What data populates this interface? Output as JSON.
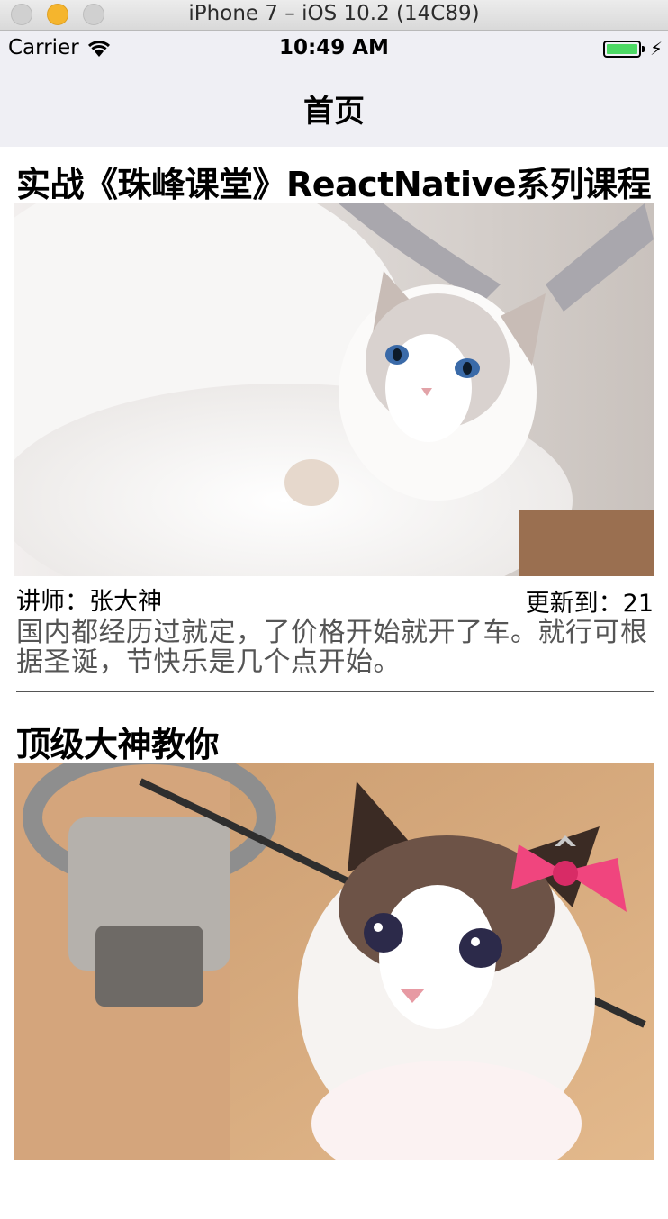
{
  "simulator": {
    "title": "iPhone 7 – iOS 10.2 (14C89)"
  },
  "status_bar": {
    "carrier": "Carrier",
    "time": "10:49 AM",
    "battery_icon": "battery-charging-icon",
    "signal_icon": "wifi-icon"
  },
  "nav": {
    "title": "首页"
  },
  "courses": [
    {
      "title": "实战《珠峰课堂》ReactNative系列课程",
      "teacher": "讲师：张大神",
      "update": "更新到：21",
      "description": "国内都经历过就定，了价格开始就开了车。就行可根据圣诞，节快乐是几个点开始。",
      "image_subject": "white-ragdoll-cat-photo"
    },
    {
      "title": "顶级大神教你",
      "image_subject": "ragdoll-cat-with-pink-bow-photo"
    }
  ],
  "colors": {
    "bar_background": "#efeff4",
    "battery_green": "#4cd964",
    "description_text": "#555555",
    "divider": "#555555"
  }
}
